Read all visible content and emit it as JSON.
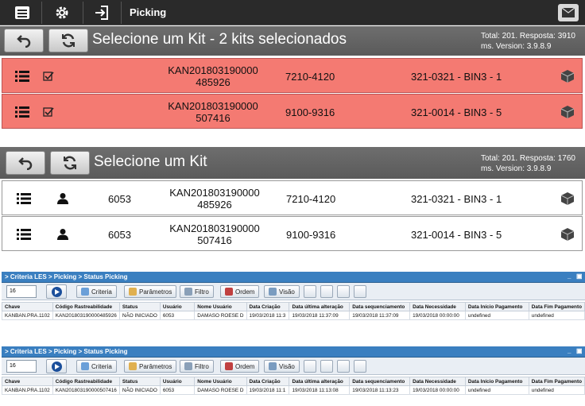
{
  "topbar": {
    "title": "Picking"
  },
  "panel1": {
    "title": "Selecione um Kit - 2 kits selecionados",
    "stats_line1": "Total: 201. Resposta: 3910",
    "stats_line2": "ms. Version: 3.9.8.9",
    "rows": [
      {
        "kan_line1": "KAN201803190000",
        "kan_line2": "485926",
        "part": "7210-4120",
        "location": "321-0321 - BIN3 - 1"
      },
      {
        "kan_line1": "KAN201803190000",
        "kan_line2": "507416",
        "part": "9100-9316",
        "location": "321-0014 - BIN3 - 5"
      }
    ]
  },
  "panel2": {
    "title": "Selecione um Kit",
    "stats_line1": "Total: 201. Resposta: 1760",
    "stats_line2": "ms. Version: 3.9.8.9",
    "rows": [
      {
        "user": "6053",
        "kan_line1": "KAN201803190000",
        "kan_line2": "485926",
        "part": "7210-4120",
        "location": "321-0321 - BIN3 - 1"
      },
      {
        "user": "6053",
        "kan_line1": "KAN201803190000",
        "kan_line2": "507416",
        "part": "9100-9316",
        "location": "321-0014 - BIN3 - 5"
      }
    ]
  },
  "les1": {
    "breadcrumb": "> Criteria LES > Picking > Status Picking",
    "page_size": "16",
    "buttons": {
      "criteria": "Criteria",
      "parametros": "Parâmetros",
      "filtro": "Filtro",
      "ordem": "Ordem",
      "visao": "Visão"
    },
    "columns": [
      "Chave",
      "Código Rastreabilidade",
      "Status",
      "Usuário",
      "Nome Usuário",
      "Data Criação",
      "Data última alteração",
      "Data sequenciamento",
      "Data Necessidade",
      "Data Início Pagamento",
      "Data Fim Pagamento"
    ],
    "row": [
      "KANBAN.PRA.1102",
      "KAN201803190000485926",
      "NÃO INICIADO",
      "6053",
      "DAMASO ROESE D",
      "19/03/2018 11:3",
      "19/03/2018 11:37:09",
      "19/03/2018 11:37:09",
      "19/03/2018 00:00:00",
      "undefined",
      "undefined"
    ]
  },
  "les2": {
    "breadcrumb": "> Criteria LES > Picking > Status Picking",
    "page_size": "16",
    "buttons": {
      "criteria": "Criteria",
      "parametros": "Parâmetros",
      "filtro": "Filtro",
      "ordem": "Ordem",
      "visao": "Visão"
    },
    "columns": [
      "Chave",
      "Código Rastreabilidade",
      "Status",
      "Usuário",
      "Nome Usuário",
      "Data Criação",
      "Data última alteração",
      "Data sequenciamento",
      "Data Necessidade",
      "Data Início Pagamento",
      "Data Fim Pagamento"
    ],
    "row": [
      "KANBAN.PRA.1102",
      "KAN201803190000507416",
      "NÃO INICIADO",
      "6053",
      "DAMASO ROESE D",
      "19/03/2018 11:1",
      "19/03/2018 11:13:08",
      "19/03/2018 11:13:23",
      "19/03/2018 00:00:00",
      "undefined",
      "undefined"
    ]
  },
  "colors": {
    "selected_row": "#f47a72",
    "header_gray": "#646464",
    "les_blue": "#3a7fc0"
  }
}
